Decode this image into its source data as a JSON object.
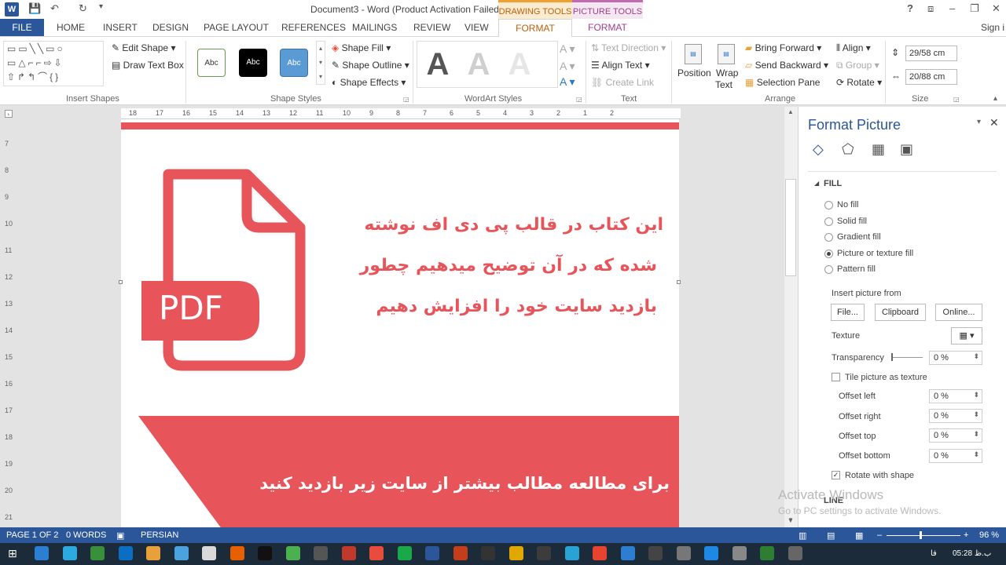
{
  "window": {
    "title": "Document3 - Word (Product Activation Failed)",
    "context_drawing": "DRAWING TOOLS",
    "context_picture": "PICTURE TOOLS",
    "signin": "Sign i",
    "help": "?"
  },
  "tabs": {
    "file": "FILE",
    "items": [
      "HOME",
      "INSERT",
      "DESIGN",
      "PAGE LAYOUT",
      "REFERENCES",
      "MAILINGS",
      "REVIEW",
      "VIEW"
    ],
    "format_drawing": "FORMAT",
    "format_picture": "FORMAT"
  },
  "ribbon": {
    "insert_shapes": {
      "label": "Insert Shapes",
      "edit_shape": "Edit Shape",
      "draw_text_box": "Draw Text Box"
    },
    "shape_styles": {
      "label": "Shape Styles",
      "sample": "Abc",
      "fill": "Shape Fill",
      "outline": "Shape Outline",
      "effects": "Shape Effects"
    },
    "wordart": {
      "label": "WordArt Styles",
      "letter": "A"
    },
    "text": {
      "label": "Text",
      "direction": "Text Direction",
      "align": "Align Text",
      "link": "Create Link"
    },
    "arrange": {
      "label": "Arrange",
      "position": "Position",
      "wrap": "Wrap",
      "wrap2": "Text",
      "bring_forward": "Bring Forward",
      "send_backward": "Send Backward",
      "selection_pane": "Selection Pane",
      "align": "Align",
      "group": "Group",
      "rotate": "Rotate"
    },
    "size": {
      "label": "Size",
      "height": "29/58 cm",
      "width": "20/88 cm"
    }
  },
  "ruler": [
    "18",
    "17",
    "16",
    "15",
    "14",
    "13",
    "12",
    "11",
    "10",
    "9",
    "8",
    "7",
    "6",
    "5",
    "4",
    "3",
    "2",
    "1",
    "2"
  ],
  "vruler": [
    "7",
    "8",
    "9",
    "10",
    "11",
    "12",
    "13",
    "14",
    "15",
    "16",
    "17",
    "18",
    "19",
    "20",
    "21"
  ],
  "document": {
    "pdf_label": "PDF",
    "line1": "این کتاب در قالب پی دی اف نوشته",
    "line2": "شده که در آن توضیح میدهیم  چطور",
    "line3": "بازدید سایت خود را افزایش دهیم",
    "banner": "برای مطالعه مطالب بیشتر از سایت زیر بازدید کنید",
    "accent": "#e7545a"
  },
  "pane": {
    "title": "Format Picture",
    "section_fill": "FILL",
    "fill_options": [
      "No fill",
      "Solid fill",
      "Gradient fill",
      "Picture or texture fill",
      "Pattern fill"
    ],
    "selected_fill": "Picture or texture fill",
    "insert_from": "Insert picture from",
    "btn_file": "File...",
    "btn_clipboard": "Clipboard",
    "btn_online": "Online...",
    "texture": "Texture",
    "transparency": "Transparency",
    "transparency_value": "0 %",
    "tile": "Tile picture as texture",
    "offset_left": "Offset left",
    "offset_right": "Offset right",
    "offset_top": "Offset top",
    "offset_bottom": "Offset bottom",
    "offset_value": "0 %",
    "rotate": "Rotate with shape",
    "section_line": "LINE"
  },
  "watermark": {
    "line1": "Activate Windows",
    "line2": "Go to PC settings to activate Windows."
  },
  "status": {
    "page": "PAGE 1 OF 2",
    "words": "0 WORDS",
    "language": "PERSIAN",
    "zoom": "96 %"
  },
  "taskbar": {
    "clock": "05:28 ب.ظ",
    "lang": "فا"
  },
  "colors": {
    "word_blue": "#2b579a",
    "drawing_tools": "#f0a030",
    "picture_tools": "#c06ab0"
  }
}
